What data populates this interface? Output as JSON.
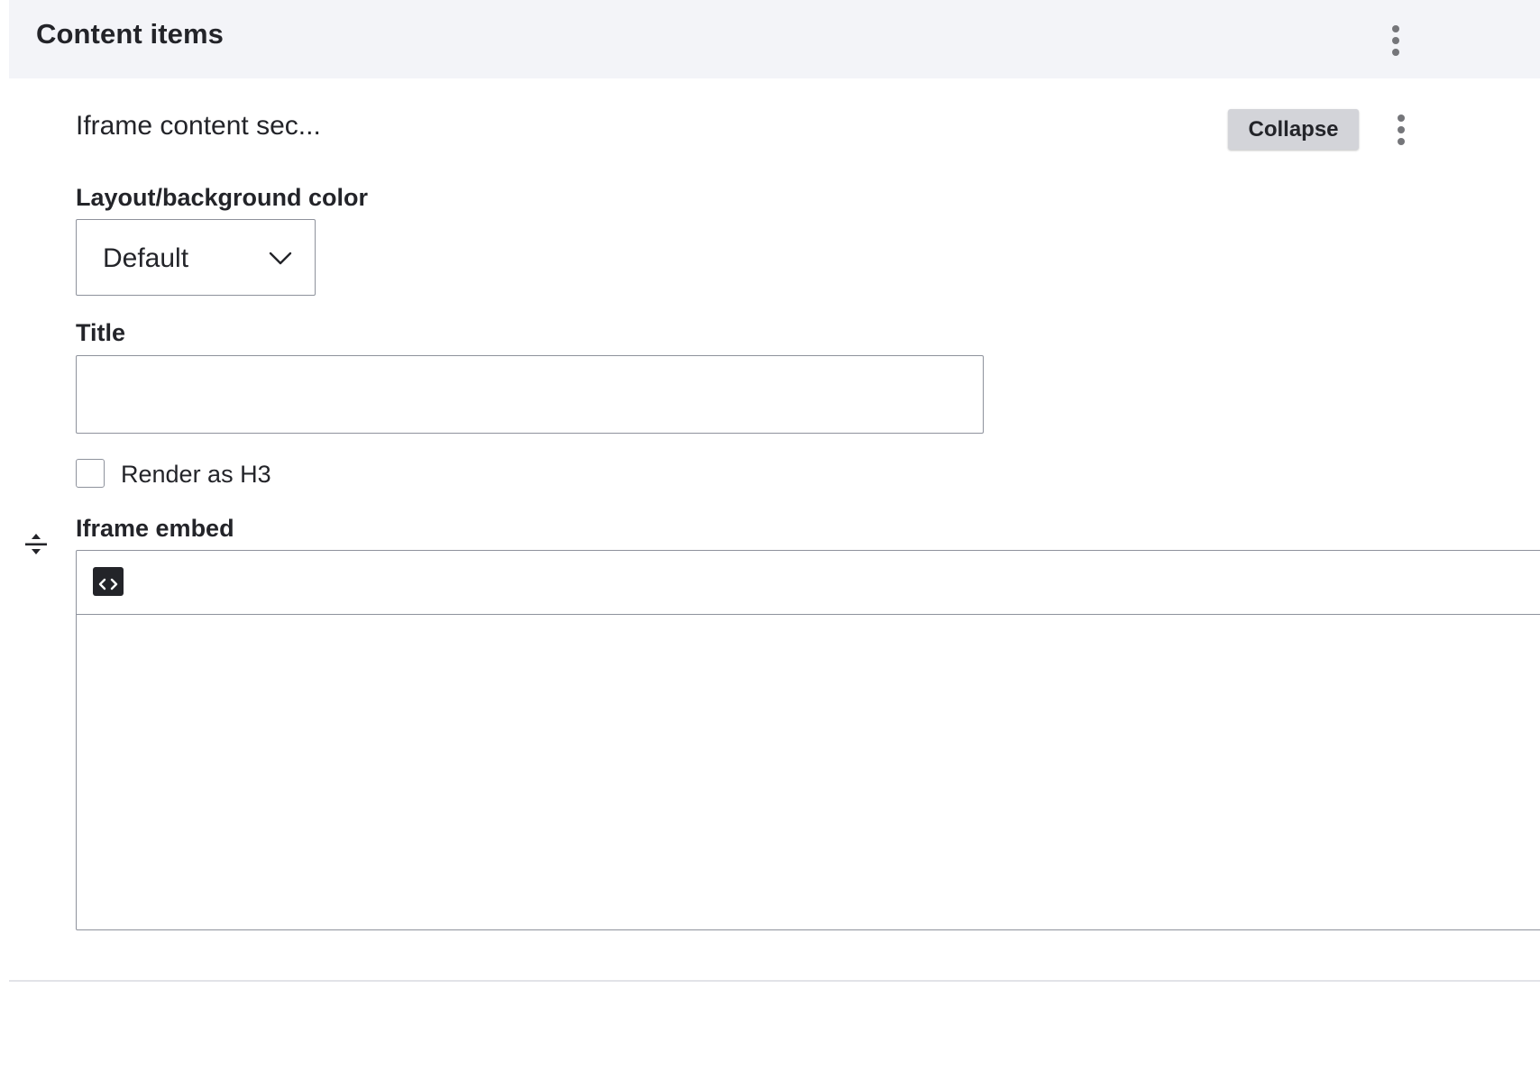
{
  "panel": {
    "title": "Content items",
    "menu_icon": "kebab-menu-icon"
  },
  "item": {
    "summary": "Iframe content sec...",
    "collapse_label": "Collapse",
    "menu_icon": "kebab-menu-icon",
    "drag_icon": "drag-handle-icon"
  },
  "fields": {
    "layout": {
      "label": "Layout/background color",
      "selected": "Default",
      "icon": "chevron-down-icon"
    },
    "title": {
      "label": "Title",
      "value": "",
      "placeholder": ""
    },
    "render_h3": {
      "label": "Render as H3",
      "checked": false
    },
    "iframe_embed": {
      "label": "Iframe embed",
      "toolbar_icon": "code-block-icon",
      "value": ""
    }
  },
  "colors": {
    "header_bg": "#f3f4f8",
    "button_bg": "#d3d4d9",
    "text": "#232429",
    "border": "#8e929c",
    "icon": "#232429"
  }
}
